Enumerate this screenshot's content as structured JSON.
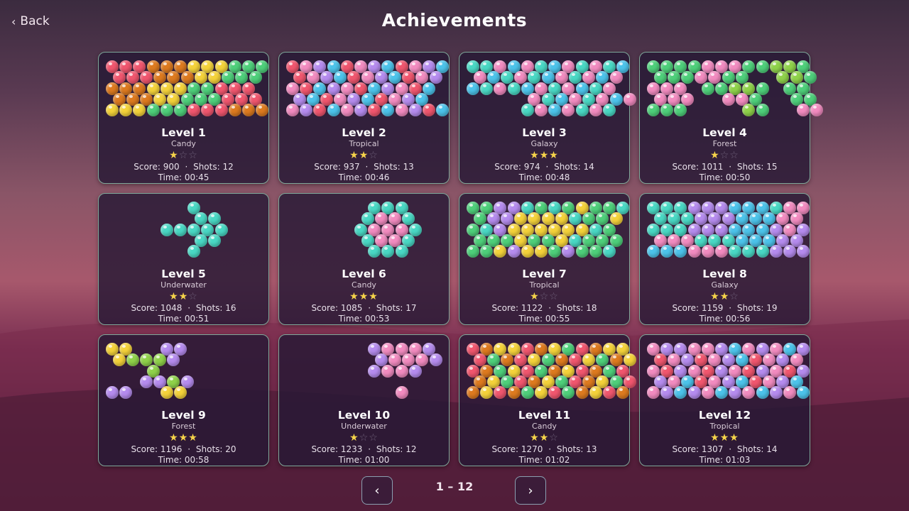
{
  "header": {
    "back_label": "Back",
    "title": "Achievements"
  },
  "pagination": {
    "indicator": "1 – 12",
    "prev_icon": "chevron-left-icon",
    "next_icon": "chevron-right-icon"
  },
  "colors": {
    "R": "#f0566e",
    "O": "#dd7a1f",
    "Y": "#f4d23a",
    "G": "#4ecf7a",
    "P": "#b58bee",
    "K": "#f28bc0",
    "B": "#4cc3ea",
    "T": "#49d8c4",
    "L": "#8fd24a",
    "star_on": "#f6d44a",
    "star_off": "#6e5f79"
  },
  "levels": [
    {
      "name": "Level 1",
      "theme": "Candy",
      "stars": 1,
      "score": "Score: 900",
      "shots": "Shots: 12",
      "time": "Time: 00:45",
      "rows": [
        "RRROOOYYYGGG",
        "RRROOOYYGGG",
        "OOOYYYGGRRR",
        "OOOYYGGGRRR",
        "YYYGGGRRROOO"
      ]
    },
    {
      "name": "Level 2",
      "theme": "Tropical",
      "stars": 2,
      "score": "Score: 937",
      "shots": "Shots: 13",
      "time": "Time: 00:46",
      "rows": [
        "RKPBRKPBRKPB",
        "RKPBRKPBRKP",
        "KRBPKRBPKRB",
        "PBRKPBRKPB",
        "KPRBKPRBKPRB"
      ]
    },
    {
      "name": "Level 3",
      "theme": "Galaxy",
      "stars": 3,
      "score": "Score: 974",
      "shots": "Shots: 14",
      "time": "Time: 00:48",
      "rows": [
        "TTKBKTBKTKTB",
        "KBTKTBKTKBK",
        "BTKTBKTKBTK",
        "....KTBKTKBK",
        "....TKBKTKT"
      ]
    },
    {
      "name": "Level 4",
      "theme": "Forest",
      "stars": 1,
      "score": "Score: 1011",
      "shots": "Shots: 15",
      "time": "Time: 00:50",
      "rows": [
        "GGGGKKKGGLLG",
        "GGGKKGG..LLG",
        "KKK.GGLLG.GG",
        "KKK..KKG..GG",
        "GGG....LG..KK"
      ]
    },
    {
      "name": "Level 5",
      "theme": "Underwater",
      "stars": 2,
      "score": "Score: 1048",
      "shots": "Shots: 16",
      "time": "Time: 00:51",
      "rows": [
        "......T.....",
        "......TT....",
        "....TTTTT...",
        "......TT....",
        "......T....."
      ]
    },
    {
      "name": "Level 6",
      "theme": "Candy",
      "stars": 3,
      "score": "Score: 1085",
      "shots": "Shots: 17",
      "time": "Time: 00:53",
      "rows": [
        "......TTT...",
        ".....TKKT...",
        ".....TKKKT..",
        ".....TKKT...",
        "......TTT..."
      ]
    },
    {
      "name": "Level 7",
      "theme": "Tropical",
      "stars": 1,
      "score": "Score: 1122",
      "shots": "Shots: 18",
      "time": "Time: 00:55",
      "rows": [
        "GGPPTGTGYGGT",
        "GPPYYYYTGGY",
        "GTPYYYYYYTG",
        "GGGYGGYTGGG",
        "GGYPYYGPGGT"
      ]
    },
    {
      "name": "Level 8",
      "theme": "Galaxy",
      "stars": 2,
      "score": "Score: 1159",
      "shots": "Shots: 19",
      "time": "Time: 00:56",
      "rows": [
        "TTTPPPBBBTKK",
        "TTTPPPBBBKK",
        "TTTPPPBBBPKP",
        "KKKTTTBBBPP",
        "BBBKKKTTTPPP"
      ]
    },
    {
      "name": "Level 9",
      "theme": "Forest",
      "stars": 3,
      "score": "Score: 1196",
      "shots": "Shots: 20",
      "time": "Time: 00:58",
      "rows": [
        "YY..PP......",
        "YLLLP.......",
        "...L........",
        "..PPLP......",
        "PP..YY......"
      ]
    },
    {
      "name": "Level 10",
      "theme": "Underwater",
      "stars": 1,
      "score": "Score: 1233",
      "shots": "Shots: 12",
      "time": "Time: 01:00",
      "rows": [
        "......PKKKP.",
        "......PKKKP",
        "......PKKP..",
        "............",
        "........K..."
      ]
    },
    {
      "name": "Level 11",
      "theme": "Candy",
      "stars": 2,
      "score": "Score: 1270",
      "shots": "Shots: 13",
      "time": "Time: 01:02",
      "rows": [
        "ROYYROYGROYY",
        "RGORYGORYGOY",
        "ROGYRGOYROGR",
        "OYGROYGROYGR",
        "OYROGYRGOYRO"
      ]
    },
    {
      "name": "Level 12",
      "theme": "Tropical",
      "stars": 3,
      "score": "Score: 1307",
      "shots": "Shots: 14",
      "time": "Time: 01:03",
      "rows": [
        "KPPKKPBKPKBP",
        "RKPRKPBRKPK",
        "KRPKRPKRPKRP",
        "PKBRKPBRKPB",
        "KPBPKBPKBPKB"
      ]
    }
  ]
}
